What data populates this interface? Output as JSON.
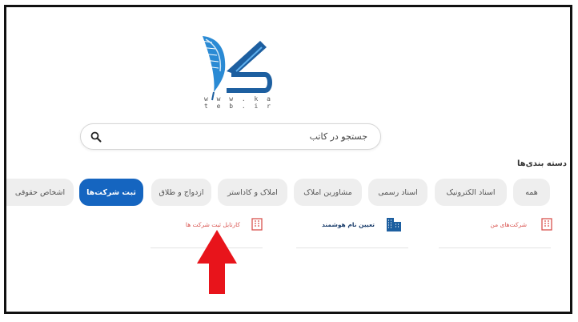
{
  "logo": {
    "url_text": "w w w . k a t e b . i r"
  },
  "search": {
    "placeholder": "جستجو در کاتب"
  },
  "categories": {
    "title": "دسته بندی‌ها",
    "chips": [
      {
        "label": "همه",
        "active": false
      },
      {
        "label": "اسناد الکترونیک",
        "active": false
      },
      {
        "label": "اسناد رسمی",
        "active": false
      },
      {
        "label": "مشاورین املاک",
        "active": false
      },
      {
        "label": "املاک و کاداستر",
        "active": false
      },
      {
        "label": "ازدواج و طلاق",
        "active": false
      },
      {
        "label": "ثبت شرکت‌ها",
        "active": true
      },
      {
        "label": "اشخاص حقوقی",
        "active": false
      }
    ]
  },
  "subcategories": [
    {
      "label": "شرکت‌های من",
      "icon": "building-doc-icon"
    },
    {
      "label": "تعیین نام هوشمند",
      "icon": "buildings-icon"
    },
    {
      "label": "کارتابل ثبت شرکت ها",
      "icon": "building-doc-icon"
    }
  ],
  "colors": {
    "accent": "#1565c0",
    "arrow": "#e8141b",
    "sub_red": "#d9534f"
  }
}
